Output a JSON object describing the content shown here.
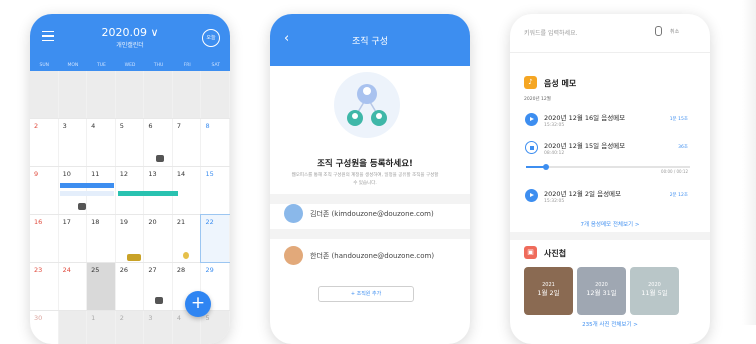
{
  "calendar": {
    "title": "2020.09 ∨",
    "subtitle": "개인캘린더",
    "today_label": "오늘",
    "weekdays": [
      "SUN",
      "MON",
      "TUE",
      "WED",
      "THU",
      "FRI",
      "SAT"
    ],
    "weeks": [
      [
        "",
        "",
        "",
        "",
        "",
        "",
        ""
      ],
      [
        "2",
        "3",
        "4",
        "5",
        "6",
        "7",
        "8"
      ],
      [
        "9",
        "10",
        "11",
        "12",
        "13",
        "14",
        "15"
      ],
      [
        "16",
        "17",
        "18",
        "19",
        "20",
        "21",
        "22"
      ],
      [
        "23",
        "24",
        "25",
        "26",
        "27",
        "28",
        "29"
      ],
      [
        "30",
        "",
        "1",
        "2",
        "3",
        "4",
        "5"
      ]
    ],
    "fab_label": "+"
  },
  "org": {
    "title": "조직 구성",
    "heading": "조직 구성원을 등록하세요!",
    "description": "웹오피스를 통해 조직 구성원의 계정을 생성하여, 일정을 공유할 조직을 구성할 수 있습니다.",
    "members": [
      {
        "name": "김더존 (kimdouzone@douzone.com)",
        "avatar_color": "#7fb0e6"
      },
      {
        "name": "한더존 (handouzone@douzone.com)",
        "avatar_color": "#e2a97a"
      }
    ],
    "add_button": "+ 조직원 추가"
  },
  "memo": {
    "search_placeholder": "키워드를 입력하세요.",
    "cancel": "취소",
    "voice_section": "음성 메모",
    "month": "2020년 12월",
    "items": [
      {
        "title": "2020년 12월 16일 음성메모",
        "time": "15:32:05",
        "duration": "1분 15초",
        "state": "play"
      },
      {
        "title": "2020년 12월 15일 음성메모",
        "time": "08:40:12",
        "duration": "36초",
        "state": "playing"
      },
      {
        "title": "2020년 12월 2일 음성메모",
        "time": "15:32:05",
        "duration": "2분 12초",
        "state": "play"
      }
    ],
    "progress": 0.12,
    "progress_label": "00:00 / 00:12",
    "voice_more": "7개 음성메모 전체보기 >",
    "photo_section": "사진첩",
    "photos": [
      {
        "year": "2021",
        "date": "1월 2일",
        "color": "#8a6a52"
      },
      {
        "year": "2020",
        "date": "12월 31일",
        "color": "#9fa7b2"
      },
      {
        "year": "2020",
        "date": "11월 5일",
        "color": "#b9c6c8"
      }
    ],
    "photo_more": "235개 사진 전체보기 >",
    "accent": "#3d8ef0"
  }
}
